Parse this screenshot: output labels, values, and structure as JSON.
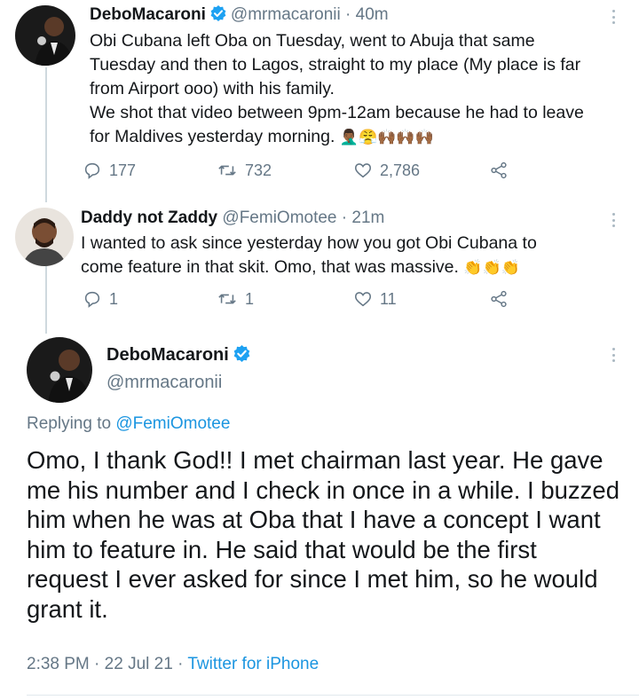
{
  "tweet1": {
    "name": "DeboMacaroni",
    "handle": "@mrmacaronii",
    "separator": "·",
    "time": "40m",
    "text": "Obi Cubana left Oba on Tuesday, went to Abuja that same\nTuesday and then to Lagos, straight to my place (My place is far\nfrom Airport ooo)  with his family.\nWe shot that video between 9pm-12am because he had to leave\nfor Maldives yesterday morning.",
    "emojis": "🤦🏾‍♂️😤🙌🏾🙌🏾🙌🏾",
    "replies": "177",
    "retweets": "732",
    "likes": "2,786"
  },
  "tweet2": {
    "name": "Daddy not Zaddy",
    "handle": "@FemiOmotee",
    "separator": "·",
    "time": "21m",
    "text": "I wanted to ask since yesterday how you got Obi Cubana to\ncome feature in that skit. Omo, that was massive.",
    "emojis": "👏👏👏",
    "replies": "1",
    "retweets": "1",
    "likes": "11"
  },
  "main": {
    "name": "DeboMacaroni",
    "handle": "@mrmacaronii",
    "replying_prefix": "Replying to",
    "replying_to": "@FemiOmotee",
    "text": "Omo, I thank God!! I met chairman last year. He gave me his number and I check in once in a while. I buzzed him when he was at Oba that I have a concept I want him to feature in. He said that would be the first request I ever asked for since I met him, so he would grant it.",
    "time": "2:38 PM",
    "separator": "·",
    "date": "22 Jul 21",
    "source": "Twitter for iPhone"
  },
  "icons": {
    "reply": "reply-icon",
    "retweet": "retweet-icon",
    "like": "heart-icon",
    "share": "share-icon",
    "verified": "verified-badge-icon",
    "more": "more-vertical-icon"
  },
  "colors": {
    "accent": "#1b95e0",
    "verified": "#1da1f2",
    "muted": "#657786",
    "text": "#14171a"
  }
}
